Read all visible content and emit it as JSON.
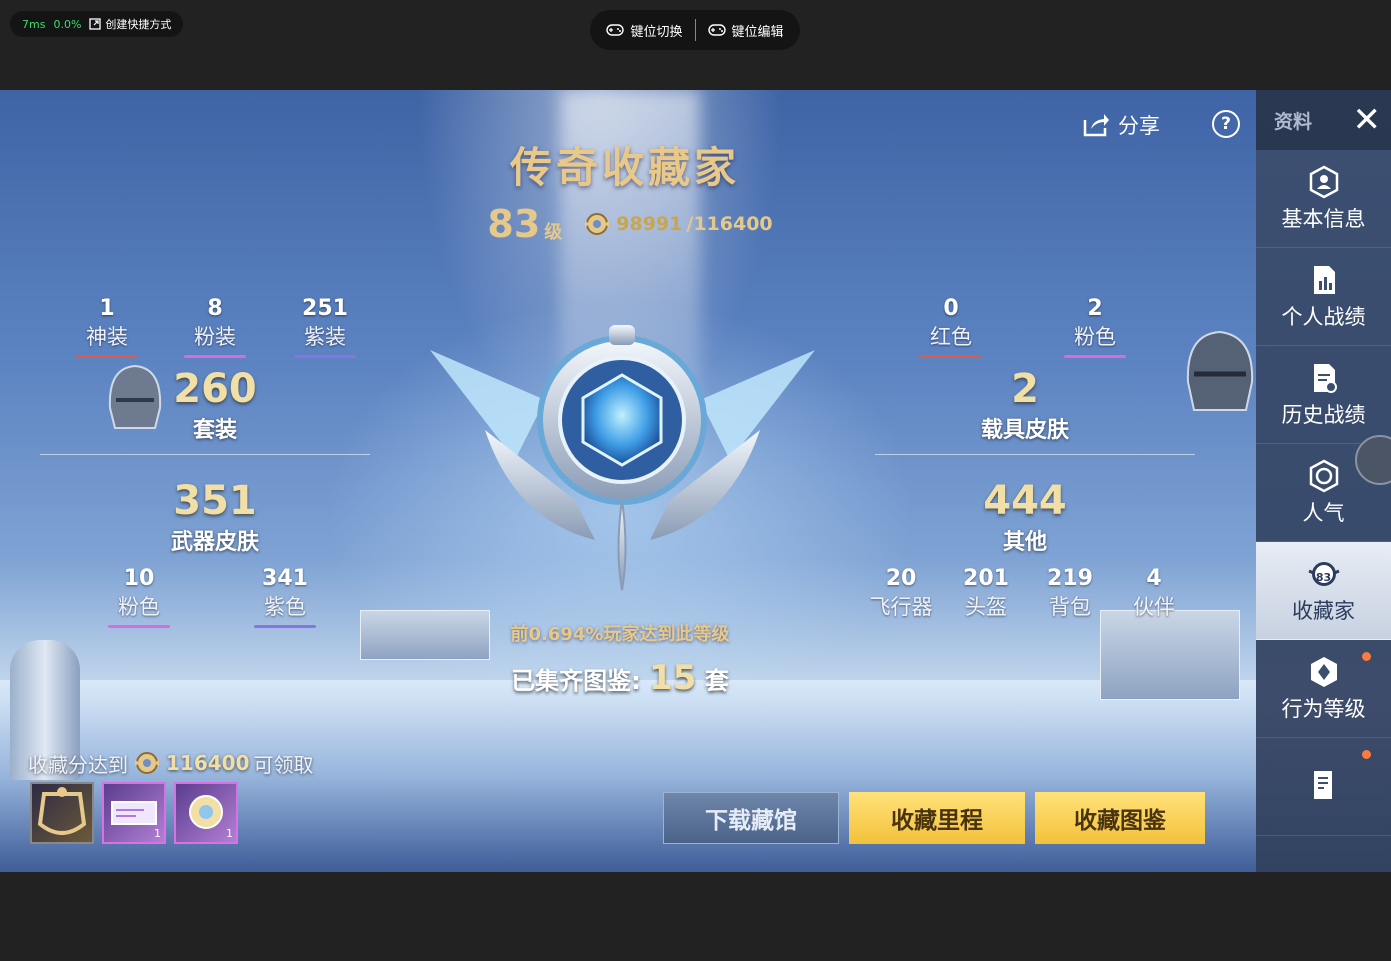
{
  "overlay": {
    "latency": "7ms",
    "loss": "0.0%",
    "shortcut": "创建快捷方式",
    "key_switch": "键位切换",
    "key_edit": "键位编辑"
  },
  "header": {
    "title": "传奇收藏家",
    "level": "83",
    "level_unit": "级",
    "score_current": "98991",
    "score_total": "/116400",
    "share": "分享",
    "help": "?"
  },
  "left_stats": {
    "outfit_tiers": [
      {
        "count": "1",
        "label": "神装",
        "color": "#e05a4a"
      },
      {
        "count": "8",
        "label": "粉装",
        "color": "#d76be0"
      },
      {
        "count": "251",
        "label": "紫装",
        "color": "#8b73e0"
      }
    ],
    "outfits": {
      "count": "260",
      "label": "套装"
    },
    "weapons": {
      "count": "351",
      "label": "武器皮肤"
    },
    "weapon_tiers": [
      {
        "count": "10",
        "label": "粉色",
        "color": "#d76be0"
      },
      {
        "count": "341",
        "label": "紫色",
        "color": "#8b73e0"
      }
    ]
  },
  "right_stats": {
    "vehicle_tiers": [
      {
        "count": "0",
        "label": "红色",
        "color": "#e05a4a"
      },
      {
        "count": "2",
        "label": "粉色",
        "color": "#d76be0"
      }
    ],
    "vehicles": {
      "count": "2",
      "label": "载具皮肤"
    },
    "others": {
      "count": "444",
      "label": "其他"
    },
    "other_items": [
      {
        "count": "20",
        "label": "飞行器"
      },
      {
        "count": "201",
        "label": "头盔"
      },
      {
        "count": "219",
        "label": "背包"
      },
      {
        "count": "4",
        "label": "伙伴"
      }
    ]
  },
  "center": {
    "percent_text": "前0.694%玩家达到此等级",
    "sets_prefix": "已集齐图鉴:",
    "sets_count": "15",
    "sets_unit": "套"
  },
  "reward": {
    "prefix": "收藏分达到",
    "value": "116400",
    "suffix": "可领取",
    "items": [
      {
        "qty": ""
      },
      {
        "qty": "1"
      },
      {
        "qty": "1"
      }
    ]
  },
  "buttons": {
    "download": "下载藏馆",
    "milestone": "收藏里程",
    "catalog": "收藏图鉴"
  },
  "sidebar": {
    "top_label": "资料",
    "close": "✕",
    "items": [
      {
        "label": "基本信息"
      },
      {
        "label": "个人战绩"
      },
      {
        "label": "历史战绩"
      },
      {
        "label": "人气"
      },
      {
        "label": "收藏家",
        "badge": "83"
      },
      {
        "label": "行为等级"
      },
      {
        "label": ""
      }
    ]
  },
  "colors": {
    "gold": "#f1dfa5",
    "button_gold": "#f3c13b",
    "notification": "#ff7a3d"
  }
}
